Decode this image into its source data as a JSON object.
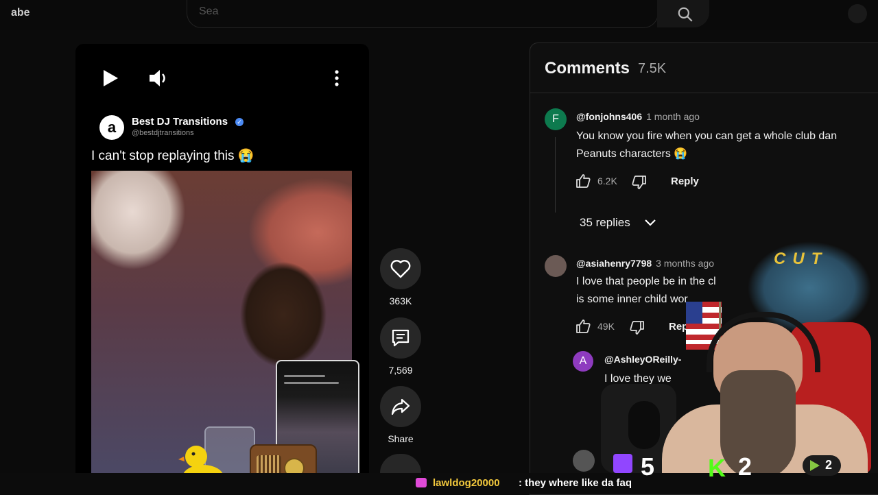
{
  "topbar": {
    "logo_fragment": "abe",
    "search_placeholder": "Sea"
  },
  "short": {
    "channel_initial": "a",
    "channel_name": "Best DJ Transitions",
    "channel_handle": "@bestdjtransitions",
    "caption": "I can't stop replaying this 😭",
    "actions": {
      "likes": "363K",
      "comments": "7,569",
      "share": "Share"
    }
  },
  "comments": {
    "title": "Comments",
    "count": "7.5K",
    "items": [
      {
        "initial": "F",
        "avatar_color": "#0d7a4e",
        "author": "@fonjohns406",
        "time": "1 month ago",
        "line1": "You know you fire when you can get a whole club dan",
        "line2": "Peanuts characters 😭",
        "likes": "6.2K",
        "reply": "Reply",
        "replies": "35 replies"
      },
      {
        "initial": "",
        "avatar_color": "#6b5a55",
        "author": "@asiahenry7798",
        "time": "3 months ago",
        "line1": "I love that people be in the cl",
        "line2": "is some inner child wor",
        "likes": "49K",
        "reply": "Reply"
      },
      {
        "initial": "A",
        "avatar_color": "#8e3bbf",
        "author": "@AshleyOReilly-",
        "line1": "I love they we",
        "line2": "😂"
      }
    ]
  },
  "overlay": {
    "cut_text": "CUT",
    "twitch_count": "5",
    "kick_label": "K",
    "kick_count": "2",
    "rumble_count": "2",
    "chat_user": "lawldog20000",
    "chat_message": ": they where like da faq"
  },
  "colors": {
    "accent_twitch": "#9146ff",
    "accent_kick": "#53fc18",
    "chat_user": "#f3c93d"
  }
}
